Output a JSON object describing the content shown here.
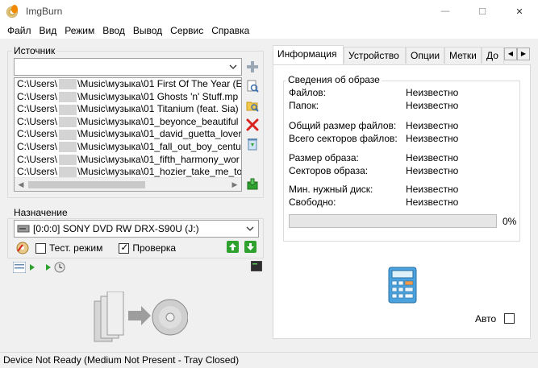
{
  "window": {
    "title": "ImgBurn",
    "minimize": "—",
    "maximize": "☐",
    "close": "✕"
  },
  "menu": [
    "Файл",
    "Вид",
    "Режим",
    "Ввод",
    "Вывод",
    "Сервис",
    "Справка"
  ],
  "source": {
    "label": "Источник",
    "combo_value": "",
    "files": [
      {
        "prefix": "C:\\Users\\",
        "rest": "\\Music\\музыка\\01 First Of The Year (E"
      },
      {
        "prefix": "C:\\Users\\",
        "rest": "\\Music\\музыка\\01 Ghosts 'n' Stuff.mp"
      },
      {
        "prefix": "C:\\Users\\",
        "rest": "\\Music\\музыка\\01 Titanium (feat. Sia)"
      },
      {
        "prefix": "C:\\Users\\",
        "rest": "\\Music\\музыка\\01_beyonce_beautiful"
      },
      {
        "prefix": "C:\\Users\\",
        "rest": "\\Music\\музыка\\01_david_guetta_lover"
      },
      {
        "prefix": "C:\\Users\\",
        "rest": "\\Music\\музыка\\01_fall_out_boy_centu"
      },
      {
        "prefix": "C:\\Users\\",
        "rest": "\\Music\\музыка\\01_fifth_harmony_wor"
      },
      {
        "prefix": "C:\\Users\\",
        "rest": "\\Music\\музыка\\01_hozier_take_me_to"
      }
    ]
  },
  "destination": {
    "label": "Назначение",
    "drive": "[0:0:0] SONY DVD RW DRX-S90U (J:)",
    "test_mode_label": "Тест. режим",
    "test_mode_checked": false,
    "verify_label": "Проверка",
    "verify_checked": true
  },
  "tabs": [
    {
      "label": "Информация",
      "active": true
    },
    {
      "label": "Устройство",
      "active": false
    },
    {
      "label": "Опции",
      "active": false
    },
    {
      "label": "Метки",
      "active": false
    },
    {
      "label": "До",
      "active": false
    }
  ],
  "image_info": {
    "group_label": "Сведения об образе",
    "rows": [
      {
        "label": "Файлов:",
        "value": "Неизвестно"
      },
      {
        "label": "Папок:",
        "value": "Неизвестно"
      },
      {
        "label": "Общий размер файлов:",
        "value": "Неизвестно"
      },
      {
        "label": "Всего секторов файлов:",
        "value": "Неизвестно"
      },
      {
        "label": "Размер образа:",
        "value": "Неизвестно"
      },
      {
        "label": "Секторов образа:",
        "value": "Неизвестно"
      },
      {
        "label": "Мин. нужный диск:",
        "value": "Неизвестно"
      },
      {
        "label": "Свободно:",
        "value": "Неизвестно"
      }
    ],
    "progress_percent": 0,
    "progress_text": "0%",
    "auto_label": "Авто",
    "auto_checked": false
  },
  "status": "Device Not Ready (Medium Not Present - Tray Closed)",
  "icons": {
    "add": "plus-icon",
    "browse_file": "magnifier-file-icon",
    "browse_folder": "magnifier-folder-icon",
    "remove": "red-x-icon",
    "clear": "recycle-bin-icon",
    "calculate": "calculator-icon"
  },
  "colors": {
    "progress_fill": "#06b025",
    "remove_red": "#d9231f",
    "go_green": "#2fa12f"
  }
}
